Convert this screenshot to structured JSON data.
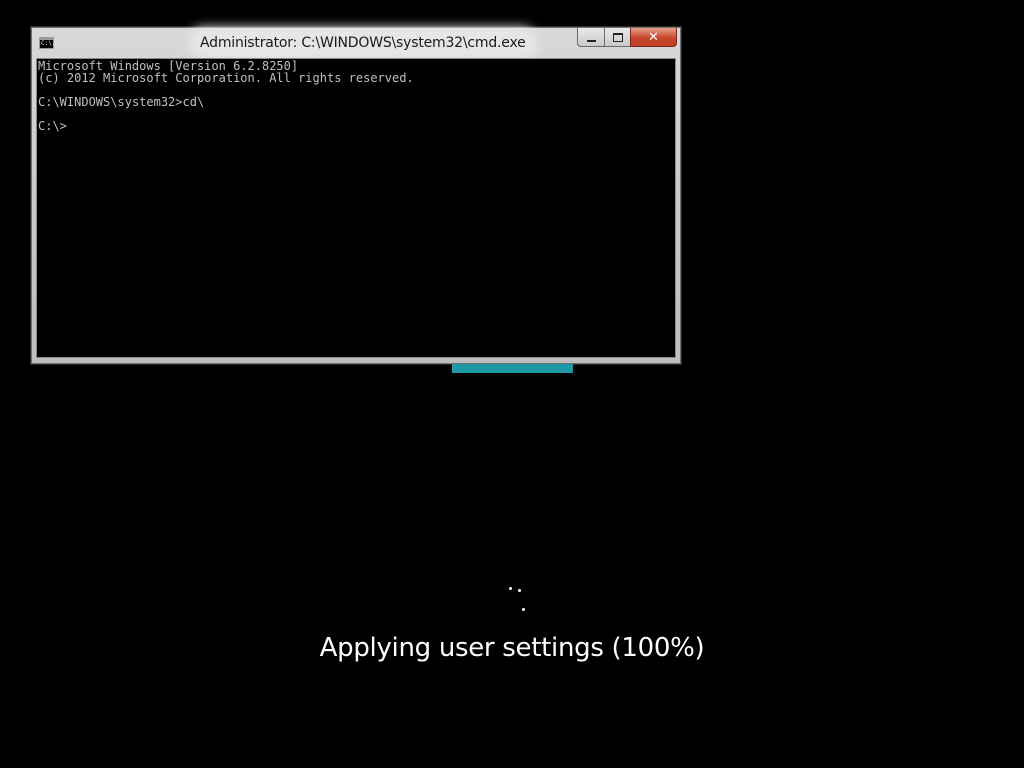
{
  "window": {
    "title": "Administrator: C:\\WINDOWS\\system32\\cmd.exe",
    "icon": "cmd-app-icon",
    "icon_text": "C:\\.",
    "controls": {
      "minimize_icon": "minimize-icon",
      "maximize_icon": "maximize-icon",
      "close_icon": "close-icon",
      "close_glyph": "✕"
    }
  },
  "console": {
    "lines": [
      "Microsoft Windows [Version 6.2.8250]",
      "(c) 2012 Microsoft Corporation. All rights reserved.",
      "",
      "C:\\WINDOWS\\system32>cd\\",
      "",
      "C:\\>"
    ]
  },
  "status": {
    "message": "Applying user settings (100%)"
  },
  "colors": {
    "background": "#000000",
    "console_text": "#c0c0c0",
    "accent_strip": "#1e9aa7",
    "close_button": "#c7452b"
  }
}
